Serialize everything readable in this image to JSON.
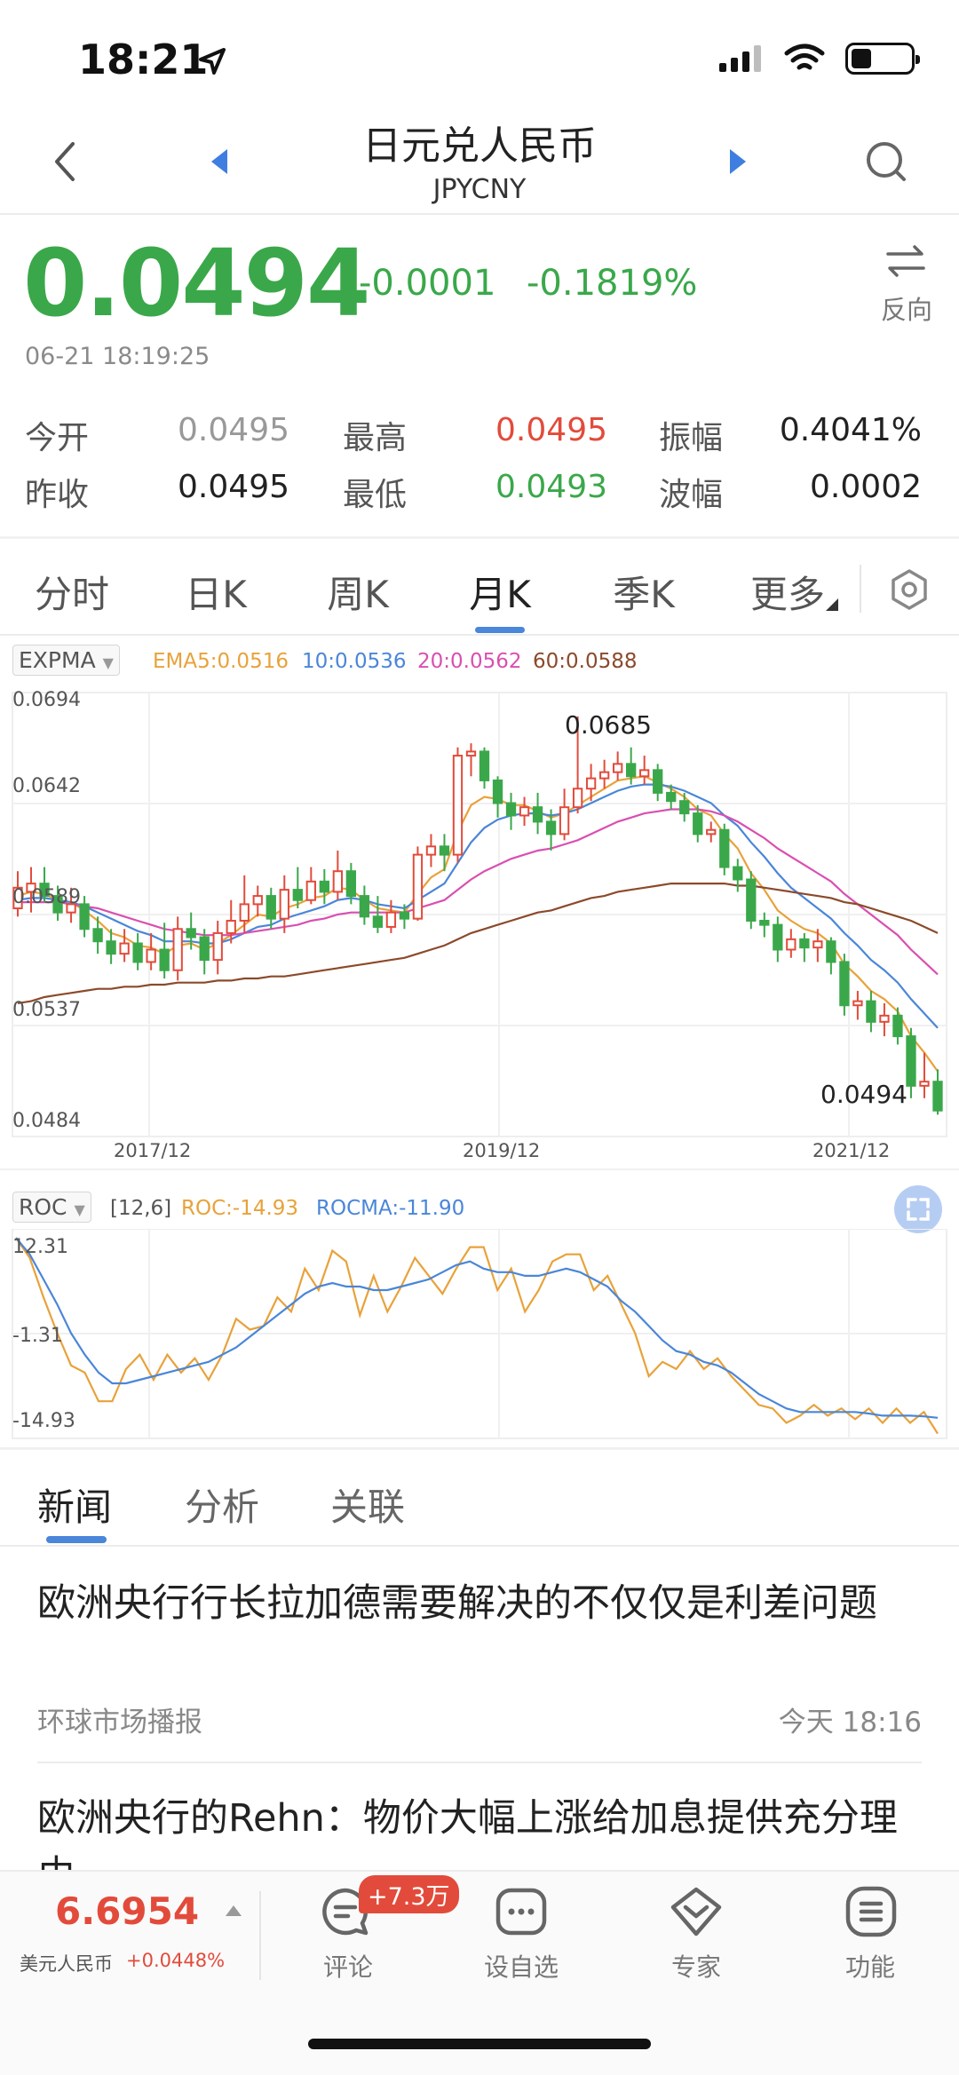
{
  "status_bar": {
    "time": "18:21"
  },
  "header": {
    "title": "日元兑人民币",
    "subtitle": "JPYCNY"
  },
  "quote": {
    "price": "0.0494",
    "change": "-0.0001",
    "change_pct": "-0.1819%",
    "timestamp": "06-21 18:19:25",
    "reverse_label": "反向",
    "colors": {
      "down": "#3aa84a",
      "up": "#e24b3b"
    }
  },
  "stats": {
    "open_label": "今开",
    "open_value": "0.0495",
    "high_label": "最高",
    "high_value": "0.0495",
    "amplitude_label": "振幅",
    "amplitude_value": "0.4041%",
    "prev_close_label": "昨收",
    "prev_close_value": "0.0495",
    "low_label": "最低",
    "low_value": "0.0493",
    "range_label": "波幅",
    "range_value": "0.0002"
  },
  "period_tabs": [
    {
      "label": "分时"
    },
    {
      "label": "日K"
    },
    {
      "label": "周K"
    },
    {
      "label": "月K",
      "active": true
    },
    {
      "label": "季K"
    },
    {
      "label": "更多"
    }
  ],
  "main_chart": {
    "indicator": "EXPMA",
    "legend": [
      {
        "label": "EMA5:0.0516",
        "color": "#e8a23a"
      },
      {
        "label": "10:0.0536",
        "color": "#4a86d9"
      },
      {
        "label": "20:0.0562",
        "color": "#d94fb0"
      },
      {
        "label": "60:0.0588",
        "color": "#8b4a2a"
      }
    ],
    "y_ticks": [
      "0.0694",
      "0.0642",
      "0.0589",
      "0.0537",
      "0.0484"
    ],
    "x_ticks": [
      "2017/12",
      "2019/12",
      "2021/12"
    ],
    "high_annotation": "0.0685",
    "last_annotation": "0.0494"
  },
  "sub_chart": {
    "indicator": "ROC",
    "params": "[12,6]",
    "legend": [
      {
        "label": "ROC:-14.93",
        "color": "#e8a23a"
      },
      {
        "label": "ROCMA:-11.90",
        "color": "#4a86d9"
      }
    ],
    "y_ticks": [
      "12.31",
      "-1.31",
      "-14.93"
    ]
  },
  "chart_data": [
    {
      "type": "candlestick",
      "title": "",
      "ylim": [
        0.0484,
        0.0694
      ],
      "x_labels": [
        "2017/12",
        "2019/12",
        "2021/12"
      ],
      "candles": [
        [
          0.0592,
          0.0602,
          0.061,
          0.0588
        ],
        [
          0.06,
          0.0604,
          0.0612,
          0.059
        ],
        [
          0.0604,
          0.0598,
          0.0612,
          0.0595
        ],
        [
          0.0598,
          0.059,
          0.0603,
          0.0586
        ],
        [
          0.059,
          0.0594,
          0.0602,
          0.0585
        ],
        [
          0.0594,
          0.0582,
          0.0598,
          0.0578
        ],
        [
          0.0582,
          0.0576,
          0.0588,
          0.057
        ],
        [
          0.0576,
          0.057,
          0.0582,
          0.0565
        ],
        [
          0.057,
          0.0575,
          0.0582,
          0.0566
        ],
        [
          0.0575,
          0.0566,
          0.058,
          0.0562
        ],
        [
          0.0566,
          0.0572,
          0.058,
          0.0562
        ],
        [
          0.0572,
          0.0562,
          0.0585,
          0.0558
        ],
        [
          0.0562,
          0.0582,
          0.0588,
          0.0557
        ],
        [
          0.0582,
          0.0578,
          0.059,
          0.0572
        ],
        [
          0.0578,
          0.0567,
          0.0582,
          0.056
        ],
        [
          0.0567,
          0.058,
          0.0586,
          0.056
        ],
        [
          0.058,
          0.0586,
          0.0596,
          0.0575
        ],
        [
          0.0586,
          0.0594,
          0.0608,
          0.058
        ],
        [
          0.0594,
          0.0598,
          0.0603,
          0.0588
        ],
        [
          0.0598,
          0.0587,
          0.0602,
          0.0582
        ],
        [
          0.0587,
          0.0601,
          0.0608,
          0.058
        ],
        [
          0.0601,
          0.0596,
          0.0612,
          0.0592
        ],
        [
          0.0596,
          0.0605,
          0.0612,
          0.0594
        ],
        [
          0.0605,
          0.06,
          0.0611,
          0.0594
        ],
        [
          0.06,
          0.061,
          0.062,
          0.0596
        ],
        [
          0.061,
          0.0598,
          0.0614,
          0.0594
        ],
        [
          0.0598,
          0.0588,
          0.0603,
          0.0584
        ],
        [
          0.0588,
          0.0583,
          0.0598,
          0.058
        ],
        [
          0.0583,
          0.059,
          0.0596,
          0.058
        ],
        [
          0.059,
          0.0587,
          0.0594,
          0.0582
        ],
        [
          0.0587,
          0.0618,
          0.0622,
          0.0586
        ],
        [
          0.0618,
          0.0622,
          0.0628,
          0.0612
        ],
        [
          0.0622,
          0.0618,
          0.0628,
          0.061
        ],
        [
          0.0618,
          0.0666,
          0.067,
          0.0614
        ],
        [
          0.0666,
          0.0668,
          0.0672,
          0.0656
        ],
        [
          0.0668,
          0.0654,
          0.067,
          0.065
        ],
        [
          0.0654,
          0.0643,
          0.0656,
          0.0636
        ],
        [
          0.0643,
          0.0637,
          0.0648,
          0.063
        ],
        [
          0.0637,
          0.0641,
          0.0646,
          0.0632
        ],
        [
          0.0641,
          0.0634,
          0.0648,
          0.0628
        ],
        [
          0.0634,
          0.0628,
          0.064,
          0.062
        ],
        [
          0.0628,
          0.0641,
          0.065,
          0.0625
        ],
        [
          0.0641,
          0.065,
          0.0685,
          0.0638
        ],
        [
          0.065,
          0.0655,
          0.0662,
          0.0644
        ],
        [
          0.0655,
          0.0658,
          0.0664,
          0.065
        ],
        [
          0.0658,
          0.0662,
          0.0668,
          0.0654
        ],
        [
          0.0662,
          0.0656,
          0.067,
          0.0652
        ],
        [
          0.0656,
          0.0659,
          0.0666,
          0.0652
        ],
        [
          0.0659,
          0.0648,
          0.0662,
          0.0644
        ],
        [
          0.0648,
          0.0644,
          0.0652,
          0.064
        ],
        [
          0.0644,
          0.0638,
          0.0648,
          0.0634
        ],
        [
          0.0638,
          0.0628,
          0.0642,
          0.0624
        ],
        [
          0.0628,
          0.063,
          0.0634,
          0.0624
        ],
        [
          0.063,
          0.0612,
          0.0633,
          0.0608
        ],
        [
          0.0612,
          0.0606,
          0.0616,
          0.06
        ],
        [
          0.0606,
          0.0586,
          0.061,
          0.0582
        ],
        [
          0.0586,
          0.0584,
          0.059,
          0.0578
        ],
        [
          0.0584,
          0.0572,
          0.0588,
          0.0566
        ],
        [
          0.0572,
          0.0577,
          0.0582,
          0.0568
        ],
        [
          0.0577,
          0.0573,
          0.058,
          0.0566
        ],
        [
          0.0573,
          0.0576,
          0.0582,
          0.0566
        ],
        [
          0.0576,
          0.0566,
          0.0578,
          0.056
        ],
        [
          0.0566,
          0.0545,
          0.057,
          0.054
        ],
        [
          0.0545,
          0.0547,
          0.0552,
          0.0538
        ],
        [
          0.0547,
          0.0537,
          0.0552,
          0.0532
        ],
        [
          0.0537,
          0.054,
          0.0546,
          0.053
        ],
        [
          0.054,
          0.053,
          0.0544,
          0.0526
        ],
        [
          0.053,
          0.0506,
          0.0534,
          0.05
        ],
        [
          0.0506,
          0.0508,
          0.0522,
          0.05
        ],
        [
          0.0508,
          0.0494,
          0.0514,
          0.0492
        ]
      ],
      "series": [
        {
          "name": "EMA5",
          "values": [
            0.0598,
            0.06,
            0.0599,
            0.0596,
            0.0595,
            0.0591,
            0.0586,
            0.058,
            0.0578,
            0.0574,
            0.0573,
            0.057,
            0.0574,
            0.0575,
            0.0572,
            0.0575,
            0.0579,
            0.0584,
            0.0589,
            0.0588,
            0.0592,
            0.0594,
            0.0597,
            0.0598,
            0.0602,
            0.0601,
            0.0596,
            0.0592,
            0.0591,
            0.059,
            0.0599,
            0.0607,
            0.0611,
            0.0629,
            0.0642,
            0.0646,
            0.0645,
            0.0642,
            0.0642,
            0.0639,
            0.0636,
            0.0638,
            0.0642,
            0.0646,
            0.065,
            0.0654,
            0.0655,
            0.0656,
            0.0653,
            0.065,
            0.0646,
            0.064,
            0.0637,
            0.0628,
            0.0621,
            0.0609,
            0.0601,
            0.0591,
            0.0586,
            0.0582,
            0.058,
            0.0575,
            0.0565,
            0.0559,
            0.0552,
            0.0548,
            0.0542,
            0.053,
            0.0522,
            0.0513
          ]
        },
        {
          "name": "10",
          "values": [
            0.0596,
            0.0597,
            0.0597,
            0.0596,
            0.0595,
            0.0593,
            0.059,
            0.0587,
            0.0584,
            0.0581,
            0.0579,
            0.0576,
            0.0576,
            0.0576,
            0.0575,
            0.0575,
            0.0577,
            0.058,
            0.0583,
            0.0584,
            0.0587,
            0.0589,
            0.0591,
            0.0593,
            0.0596,
            0.0597,
            0.0596,
            0.0594,
            0.0593,
            0.0592,
            0.0596,
            0.06,
            0.0604,
            0.0614,
            0.0624,
            0.0631,
            0.0635,
            0.0637,
            0.0638,
            0.0638,
            0.0637,
            0.0638,
            0.064,
            0.0643,
            0.0646,
            0.0649,
            0.0651,
            0.0652,
            0.0652,
            0.0651,
            0.0649,
            0.0646,
            0.0643,
            0.0637,
            0.0632,
            0.0624,
            0.0617,
            0.0609,
            0.0602,
            0.0597,
            0.0592,
            0.0587,
            0.058,
            0.0574,
            0.0567,
            0.0562,
            0.0556,
            0.0548,
            0.0541,
            0.0534
          ]
        },
        {
          "name": "20",
          "values": [
            0.0595,
            0.0595,
            0.0595,
            0.0595,
            0.0594,
            0.0593,
            0.0592,
            0.059,
            0.0588,
            0.0586,
            0.0584,
            0.0582,
            0.0581,
            0.058,
            0.0579,
            0.0579,
            0.0579,
            0.058,
            0.0581,
            0.0582,
            0.0583,
            0.0584,
            0.0586,
            0.0587,
            0.0589,
            0.059,
            0.059,
            0.059,
            0.059,
            0.059,
            0.0592,
            0.0594,
            0.0596,
            0.0601,
            0.0606,
            0.061,
            0.0613,
            0.0616,
            0.0618,
            0.062,
            0.0621,
            0.0623,
            0.0625,
            0.0628,
            0.0631,
            0.0634,
            0.0636,
            0.0638,
            0.0639,
            0.064,
            0.064,
            0.064,
            0.0639,
            0.0637,
            0.0634,
            0.063,
            0.0626,
            0.0621,
            0.0617,
            0.0613,
            0.0609,
            0.0605,
            0.0599,
            0.0594,
            0.0589,
            0.0584,
            0.0579,
            0.0572,
            0.0566,
            0.056
          ]
        },
        {
          "name": "60",
          "values": [
            0.0546,
            0.0547,
            0.0549,
            0.055,
            0.0551,
            0.0552,
            0.0553,
            0.0553,
            0.0554,
            0.0554,
            0.0555,
            0.0555,
            0.0556,
            0.0556,
            0.0556,
            0.0557,
            0.0557,
            0.0558,
            0.0558,
            0.0559,
            0.0559,
            0.056,
            0.0561,
            0.0562,
            0.0563,
            0.0564,
            0.0565,
            0.0566,
            0.0567,
            0.0568,
            0.057,
            0.0572,
            0.0574,
            0.0577,
            0.058,
            0.0582,
            0.0584,
            0.0586,
            0.0588,
            0.059,
            0.0591,
            0.0593,
            0.0595,
            0.0597,
            0.0598,
            0.06,
            0.0601,
            0.0602,
            0.0603,
            0.0604,
            0.0604,
            0.0604,
            0.0604,
            0.0604,
            0.0603,
            0.0603,
            0.0602,
            0.0601,
            0.06,
            0.0599,
            0.0598,
            0.0597,
            0.0595,
            0.0594,
            0.0592,
            0.059,
            0.0588,
            0.0586,
            0.0583,
            0.058
          ]
        }
      ]
    },
    {
      "type": "line",
      "title": "",
      "ylim": [
        -14.93,
        12.31
      ],
      "series": [
        {
          "name": "ROC",
          "values": [
            12.3,
            9.5,
            4.0,
            -1.0,
            -5.5,
            -6.5,
            -10.5,
            -10.5,
            -6.0,
            -4.0,
            -7.5,
            -4.0,
            -6.5,
            -4.5,
            -7.5,
            -4.0,
            1.0,
            -0.5,
            0.0,
            4.0,
            2.0,
            8.0,
            5.0,
            10.5,
            9.0,
            1.5,
            7.0,
            2.0,
            5.5,
            9.5,
            7.0,
            4.5,
            8.0,
            11.0,
            11.0,
            5.0,
            8.0,
            2.0,
            5.0,
            9.0,
            10.0,
            10.0,
            5.0,
            7.0,
            3.0,
            -1.0,
            -7.0,
            -5.0,
            -6.0,
            -3.5,
            -6.0,
            -4.5,
            -7.0,
            -9.0,
            -11.0,
            -11.5,
            -13.5,
            -12.5,
            -11.0,
            -12.5,
            -11.5,
            -13.0,
            -11.5,
            -13.5,
            -11.5,
            -13.5,
            -12.0,
            -15.0
          ]
        },
        {
          "name": "ROCMA",
          "values": [
            12.3,
            10.0,
            6.5,
            3.0,
            -1.0,
            -4.0,
            -6.5,
            -8.0,
            -8.0,
            -7.5,
            -7.0,
            -6.5,
            -6.0,
            -5.5,
            -5.0,
            -4.0,
            -3.0,
            -1.5,
            0.0,
            1.5,
            3.0,
            4.5,
            5.5,
            6.0,
            5.5,
            5.5,
            5.0,
            5.0,
            5.5,
            6.0,
            6.5,
            7.5,
            8.5,
            9.0,
            8.0,
            7.5,
            7.5,
            7.0,
            7.0,
            7.5,
            8.0,
            7.5,
            6.5,
            5.5,
            3.5,
            2.0,
            0.0,
            -2.0,
            -3.5,
            -4.0,
            -5.0,
            -5.5,
            -6.5,
            -8.0,
            -9.5,
            -10.5,
            -11.5,
            -12.0,
            -12.0,
            -12.0,
            -12.0,
            -12.0,
            -12.2,
            -12.5,
            -12.5,
            -12.5,
            -12.6,
            -12.8
          ]
        }
      ]
    }
  ],
  "news": {
    "tabs": [
      {
        "label": "新闻",
        "active": true
      },
      {
        "label": "分析"
      },
      {
        "label": "关联"
      }
    ],
    "items": [
      {
        "title": "欧洲央行行长拉加德需要解决的不仅仅是利差问题",
        "source": "环球市场播报",
        "time": "今天 18:16"
      },
      {
        "title": "欧洲央行的Rehn：物价大幅上涨给加息提供充分理由",
        "source": "",
        "time": ""
      }
    ]
  },
  "bottom_bar": {
    "ticker_price": "6.6954",
    "ticker_name": "美元人民币",
    "ticker_change": "+0.0448%",
    "comment_badge": "+7.3万",
    "nav": [
      {
        "label": "评论",
        "icon": "comment-icon"
      },
      {
        "label": "设自选",
        "icon": "watchlist-icon"
      },
      {
        "label": "专家",
        "icon": "expert-icon"
      },
      {
        "label": "功能",
        "icon": "menu-icon"
      }
    ]
  }
}
